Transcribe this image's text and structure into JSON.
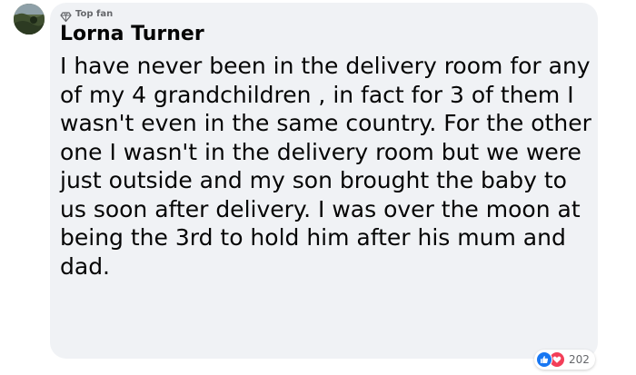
{
  "comment": {
    "badge": {
      "icon": "diamond-icon",
      "label": "Top fan"
    },
    "author": "Lorna Turner",
    "text": "I have never been in the delivery room for any of my 4 grandchildren , in fact for 3 of them I wasn't even in the same country. For the other one I wasn't in the delivery room but we were just outside and my son brought the baby to us soon after delivery. I was over the moon at being the 3rd to hold him after his mum and dad.",
    "reactions": {
      "icons": [
        "like-icon",
        "love-icon"
      ],
      "count": "202"
    }
  },
  "colors": {
    "bubble": "#f0f2f5",
    "text": "#050505",
    "muted": "#65676b",
    "like": "#1877f2",
    "love": "#f33e58"
  }
}
